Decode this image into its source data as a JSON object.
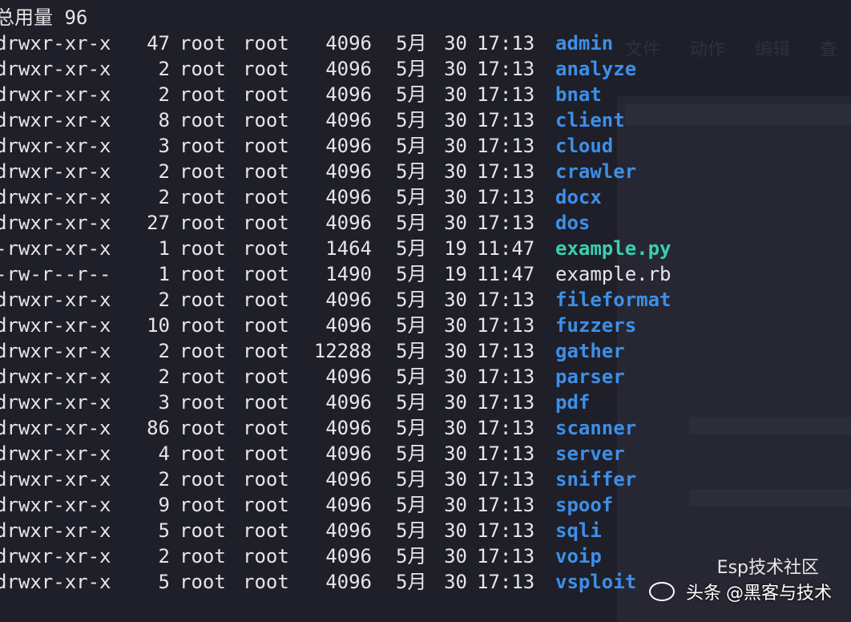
{
  "total": {
    "label": "总用量",
    "value": "96"
  },
  "background_menu": [
    "文件",
    "动作",
    "编辑",
    "查"
  ],
  "entries": [
    {
      "perm": "drwxr-xr-x",
      "links": "47",
      "user": "root",
      "group": "root",
      "size": "4096",
      "month": "5月",
      "day": "30",
      "time": "17:13",
      "name": "admin",
      "kind": "dir"
    },
    {
      "perm": "drwxr-xr-x",
      "links": "2",
      "user": "root",
      "group": "root",
      "size": "4096",
      "month": "5月",
      "day": "30",
      "time": "17:13",
      "name": "analyze",
      "kind": "dir"
    },
    {
      "perm": "drwxr-xr-x",
      "links": "2",
      "user": "root",
      "group": "root",
      "size": "4096",
      "month": "5月",
      "day": "30",
      "time": "17:13",
      "name": "bnat",
      "kind": "dir"
    },
    {
      "perm": "drwxr-xr-x",
      "links": "8",
      "user": "root",
      "group": "root",
      "size": "4096",
      "month": "5月",
      "day": "30",
      "time": "17:13",
      "name": "client",
      "kind": "dir"
    },
    {
      "perm": "drwxr-xr-x",
      "links": "3",
      "user": "root",
      "group": "root",
      "size": "4096",
      "month": "5月",
      "day": "30",
      "time": "17:13",
      "name": "cloud",
      "kind": "dir"
    },
    {
      "perm": "drwxr-xr-x",
      "links": "2",
      "user": "root",
      "group": "root",
      "size": "4096",
      "month": "5月",
      "day": "30",
      "time": "17:13",
      "name": "crawler",
      "kind": "dir"
    },
    {
      "perm": "drwxr-xr-x",
      "links": "2",
      "user": "root",
      "group": "root",
      "size": "4096",
      "month": "5月",
      "day": "30",
      "time": "17:13",
      "name": "docx",
      "kind": "dir"
    },
    {
      "perm": "drwxr-xr-x",
      "links": "27",
      "user": "root",
      "group": "root",
      "size": "4096",
      "month": "5月",
      "day": "30",
      "time": "17:13",
      "name": "dos",
      "kind": "dir"
    },
    {
      "perm": "-rwxr-xr-x",
      "links": "1",
      "user": "root",
      "group": "root",
      "size": "1464",
      "month": "5月",
      "day": "19",
      "time": "11:47",
      "name": "example.py",
      "kind": "exec"
    },
    {
      "perm": "-rw-r--r--",
      "links": "1",
      "user": "root",
      "group": "root",
      "size": "1490",
      "month": "5月",
      "day": "19",
      "time": "11:47",
      "name": "example.rb",
      "kind": "file"
    },
    {
      "perm": "drwxr-xr-x",
      "links": "2",
      "user": "root",
      "group": "root",
      "size": "4096",
      "month": "5月",
      "day": "30",
      "time": "17:13",
      "name": "fileformat",
      "kind": "dir"
    },
    {
      "perm": "drwxr-xr-x",
      "links": "10",
      "user": "root",
      "group": "root",
      "size": "4096",
      "month": "5月",
      "day": "30",
      "time": "17:13",
      "name": "fuzzers",
      "kind": "dir"
    },
    {
      "perm": "drwxr-xr-x",
      "links": "2",
      "user": "root",
      "group": "root",
      "size": "12288",
      "month": "5月",
      "day": "30",
      "time": "17:13",
      "name": "gather",
      "kind": "dir"
    },
    {
      "perm": "drwxr-xr-x",
      "links": "2",
      "user": "root",
      "group": "root",
      "size": "4096",
      "month": "5月",
      "day": "30",
      "time": "17:13",
      "name": "parser",
      "kind": "dir"
    },
    {
      "perm": "drwxr-xr-x",
      "links": "3",
      "user": "root",
      "group": "root",
      "size": "4096",
      "month": "5月",
      "day": "30",
      "time": "17:13",
      "name": "pdf",
      "kind": "dir"
    },
    {
      "perm": "drwxr-xr-x",
      "links": "86",
      "user": "root",
      "group": "root",
      "size": "4096",
      "month": "5月",
      "day": "30",
      "time": "17:13",
      "name": "scanner",
      "kind": "dir"
    },
    {
      "perm": "drwxr-xr-x",
      "links": "4",
      "user": "root",
      "group": "root",
      "size": "4096",
      "month": "5月",
      "day": "30",
      "time": "17:13",
      "name": "server",
      "kind": "dir"
    },
    {
      "perm": "drwxr-xr-x",
      "links": "2",
      "user": "root",
      "group": "root",
      "size": "4096",
      "month": "5月",
      "day": "30",
      "time": "17:13",
      "name": "sniffer",
      "kind": "dir"
    },
    {
      "perm": "drwxr-xr-x",
      "links": "9",
      "user": "root",
      "group": "root",
      "size": "4096",
      "month": "5月",
      "day": "30",
      "time": "17:13",
      "name": "spoof",
      "kind": "dir"
    },
    {
      "perm": "drwxr-xr-x",
      "links": "5",
      "user": "root",
      "group": "root",
      "size": "4096",
      "month": "5月",
      "day": "30",
      "time": "17:13",
      "name": "sqli",
      "kind": "dir"
    },
    {
      "perm": "drwxr-xr-x",
      "links": "2",
      "user": "root",
      "group": "root",
      "size": "4096",
      "month": "5月",
      "day": "30",
      "time": "17:13",
      "name": "voip",
      "kind": "dir"
    },
    {
      "perm": "drwxr-xr-x",
      "links": "5",
      "user": "root",
      "group": "root",
      "size": "4096",
      "month": "5月",
      "day": "30",
      "time": "17:13",
      "name": "vsploit",
      "kind": "dir"
    }
  ],
  "watermark": {
    "sub": "Esp技术社区",
    "brand": "头条",
    "handle": "@黑客与技术"
  },
  "colors": {
    "background": "#1e1f29",
    "text": "#e6e6e6",
    "directory": "#3d8fe8",
    "executable": "#3bcfb0"
  }
}
